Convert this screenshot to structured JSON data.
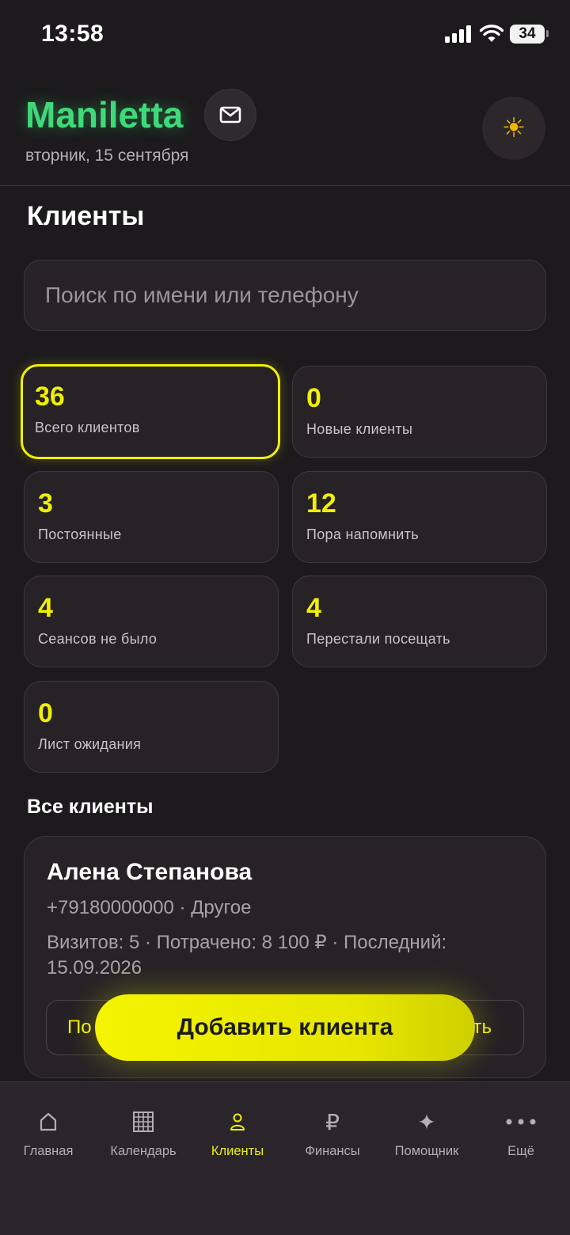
{
  "status_bar": {
    "time": "13:58",
    "battery": "34"
  },
  "header": {
    "brand": "Maniletta",
    "date": "вторник, 15 сентября"
  },
  "page": {
    "title": "Клиенты",
    "search_placeholder": "Поиск по имени или телефону"
  },
  "stats": [
    {
      "value": "36",
      "label": "Всего клиентов",
      "active": true
    },
    {
      "value": "0",
      "label": "Новые клиенты"
    },
    {
      "value": "3",
      "label": "Постоянные"
    },
    {
      "value": "12",
      "label": "Пора напомнить"
    },
    {
      "value": "4",
      "label": "Сеансов не было"
    },
    {
      "value": "4",
      "label": "Перестали посещать"
    },
    {
      "value": "0",
      "label": "Лист ожидания"
    }
  ],
  "section_title": "Все клиенты",
  "client": {
    "name": "Алена Степанова",
    "contact": "+79180000000 · Другое",
    "stats": "Визитов: 5 · Потрачено: 8 100 ₽ · Последний: 15.09.2026",
    "action_left_visible": "По",
    "action_right_visible": "ть"
  },
  "fab_label": "Добавить клиента",
  "tabs": [
    {
      "label": "Главная",
      "icon": "home-icon"
    },
    {
      "label": "Календарь",
      "icon": "calendar-icon"
    },
    {
      "label": "Клиенты",
      "icon": "clients-icon",
      "active": true
    },
    {
      "label": "Финансы",
      "icon": "ruble-icon"
    },
    {
      "label": "Помощник",
      "icon": "sparkle-icon"
    },
    {
      "label": "Ещё",
      "icon": "more-icon"
    }
  ],
  "colors": {
    "accent": "#f0f000",
    "brand": "#3fd97a",
    "background": "#1c1a1c"
  }
}
